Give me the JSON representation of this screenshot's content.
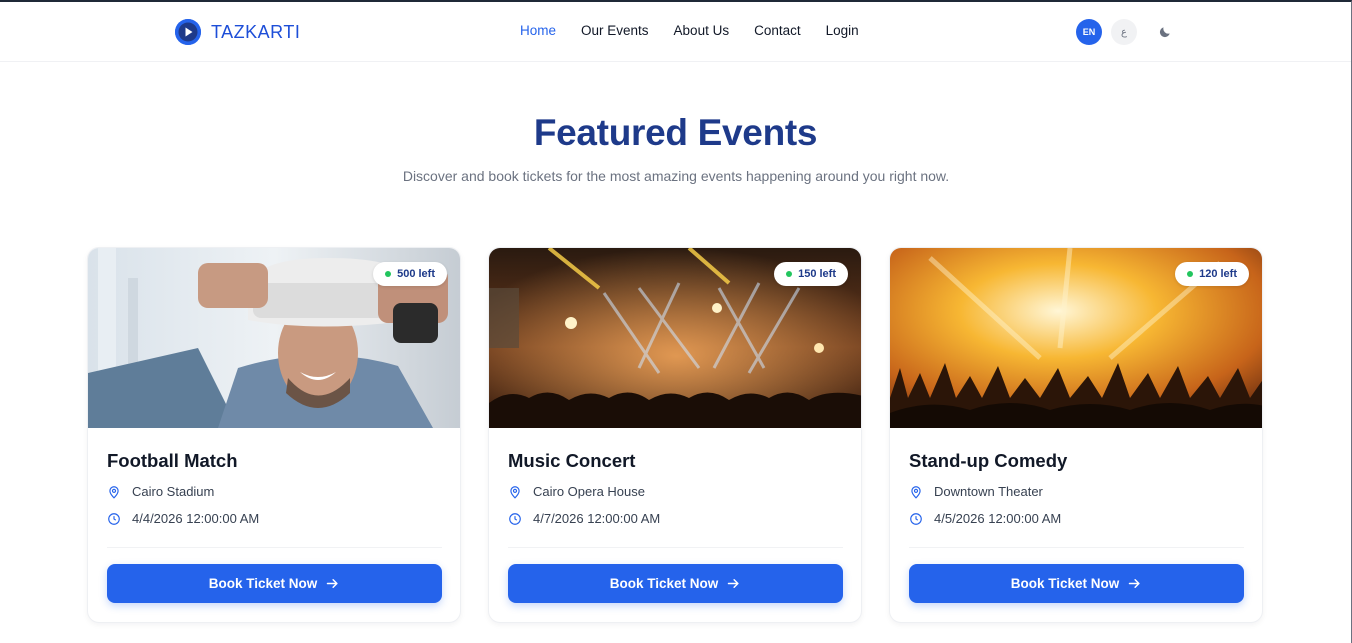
{
  "nav": {
    "brand": "TAZKARTI",
    "links": [
      "Home",
      "Our Events",
      "About Us",
      "Contact",
      "Login"
    ],
    "active_link": "Home",
    "lang_en": "EN",
    "lang_ar": "ع",
    "theme_icon": "moon-icon"
  },
  "hero": {
    "title": "Featured Events",
    "subtitle": "Discover and book tickets for the most amazing events happening around you right now."
  },
  "events": [
    {
      "title": "Football Match",
      "location": "Cairo Stadium",
      "date": "4/4/2026 12:00:00 AM",
      "left": "500 left",
      "button": "Book Ticket Now",
      "image": "man-with-vr-headset"
    },
    {
      "title": "Music Concert",
      "location": "Cairo Opera House",
      "date": "4/7/2026 12:00:00 AM",
      "left": "150 left",
      "button": "Book Ticket Now",
      "image": "concert-stage-lights"
    },
    {
      "title": "Stand-up Comedy",
      "location": "Downtown Theater",
      "date": "4/5/2026 12:00:00 AM",
      "left": "120 left",
      "button": "Book Ticket Now",
      "image": "crowd-golden-lights"
    }
  ],
  "colors": {
    "primary": "#2563eb",
    "title": "#1e3a8a",
    "badge_dot": "#22c55e",
    "muted_text": "#6b7280"
  }
}
